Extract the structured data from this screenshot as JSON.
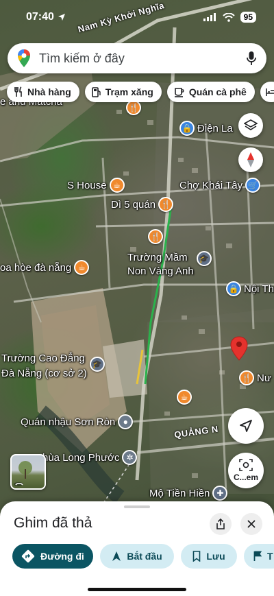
{
  "status_bar": {
    "time": "07:40",
    "battery": "95"
  },
  "search": {
    "placeholder": "Tìm kiếm ở đây"
  },
  "chips": [
    {
      "label": "Nhà hàng",
      "icon": "fork-knife-icon"
    },
    {
      "label": "Trạm xăng",
      "icon": "gas-pump-icon"
    },
    {
      "label": "Quán cà phê",
      "icon": "coffee-cup-icon"
    }
  ],
  "map": {
    "roads": {
      "nam_ky": "Nam Kỳ Khởi Nghĩa",
      "quang_n": "QUẢNG N"
    },
    "pois": {
      "matcha": "e and Matcha",
      "dien_la": "Điện La",
      "s_house": "S House",
      "cho_khai_tay": "Chợ Khái Tây",
      "di_5_quan": "Dì 5 quán",
      "truong_mam_non": "Trường Mầm\nNon Vàng Anh",
      "hoa_hoe": "oa hòe đà nẵng",
      "noi_th": "Nội Th",
      "cao_dang": "Trường Cao Đẳng\nĐà Nẵng (cơ sở 2)",
      "nu": "Nư",
      "quan_nhau": "Quán nhậu Sơn Ròn",
      "chua_long_phuoc": "hùa Long Phước",
      "mo_tien_hien": "Mộ Tiền Hiền"
    },
    "street_view_label": "C...em"
  },
  "sheet": {
    "title": "Ghim đã thả",
    "actions": [
      {
        "label": "Đường đi",
        "icon": "directions-icon"
      },
      {
        "label": "Bắt đầu",
        "icon": "navigation-arrow-icon"
      },
      {
        "label": "Lưu",
        "icon": "bookmark-icon"
      },
      {
        "label": "T",
        "icon": "flag-icon"
      }
    ]
  },
  "colors": {
    "primary_button": "#0b5563",
    "secondary_button": "#d3ecf3",
    "pin_red": "#e5322d",
    "food_pin": "#f0892d",
    "shop_pin": "#3a84e0"
  }
}
